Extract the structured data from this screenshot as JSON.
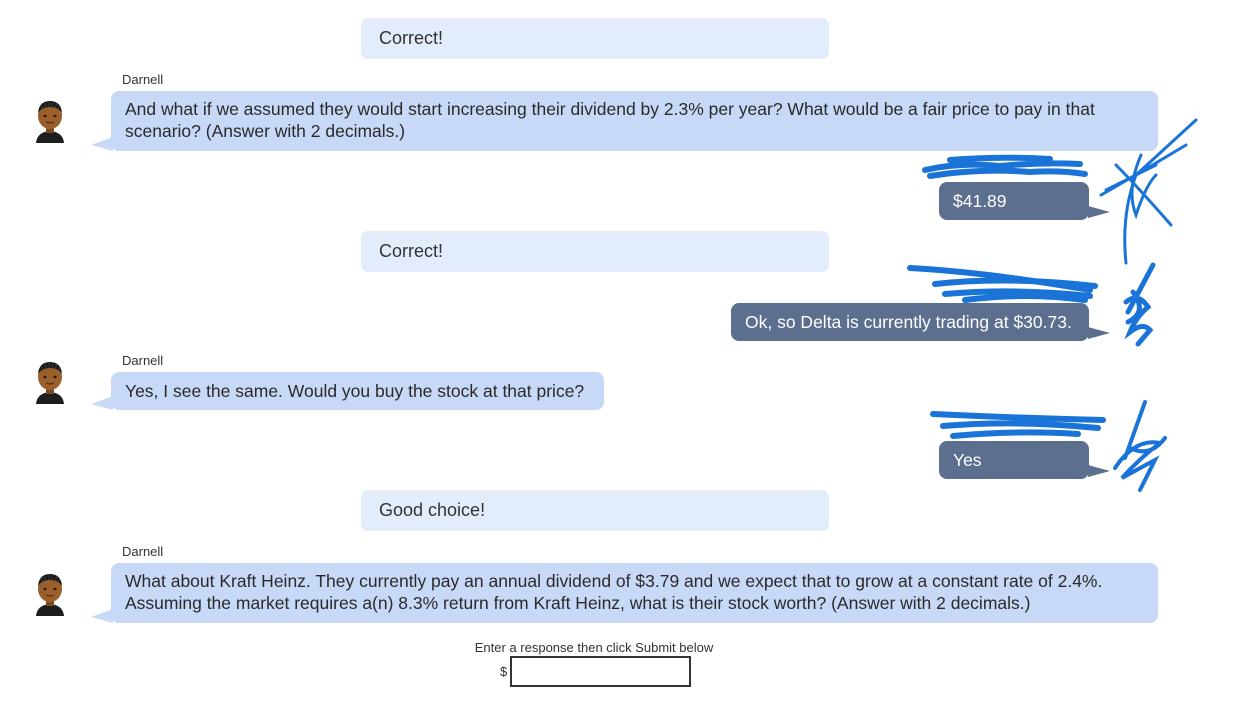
{
  "conversation": {
    "feedback": [
      {
        "text": "Correct!"
      },
      {
        "text": "Correct!"
      },
      {
        "text": "Good choice!"
      }
    ],
    "bot_messages": [
      {
        "speaker": "Darnell",
        "text": "And what if we assumed they would start increasing their dividend by 2.3% per year? What would be a fair price to pay in that scenario? (Answer with 2 decimals.)"
      },
      {
        "speaker": "Darnell",
        "text": "Yes, I see the same. Would you buy the stock at that price?"
      },
      {
        "speaker": "Darnell",
        "text": "What about Kraft Heinz. They currently pay an annual dividend of $3.79 and we expect that to grow at a constant rate of 2.4%. Assuming the market requires a(n) 8.3% return from Kraft Heinz, what is their stock worth? (Answer with 2 decimals.)"
      }
    ],
    "user_messages": [
      {
        "text": "$41.89"
      },
      {
        "text": "Ok, so Delta is currently trading at $30.73."
      },
      {
        "text": "Yes"
      }
    ]
  },
  "response_form": {
    "prompt": "Enter a response then click Submit below",
    "currency_symbol": "$",
    "value": ""
  },
  "colors": {
    "feedback_bg": "#e3ecfb",
    "bot_bubble_bg": "#c7d9f7",
    "user_bubble_bg": "#5c6f8f",
    "redaction_scribble": "#1a73d6"
  },
  "icons": {
    "avatar": "person-avatar-icon"
  }
}
